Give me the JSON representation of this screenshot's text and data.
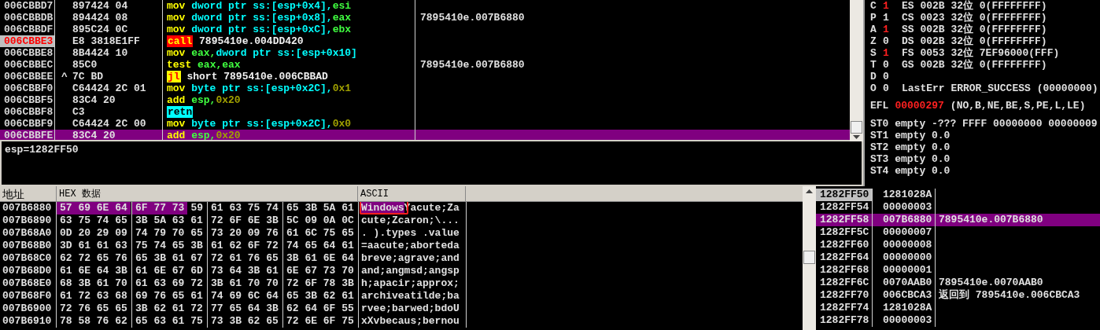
{
  "disassembly": {
    "rows": [
      {
        "address": "006CBBD7",
        "bytes": "897424 04",
        "tokens": [
          {
            "text": "mov",
            "kind": "mnemonic"
          },
          {
            "text": "dword ptr ss:[esp+0x4],",
            "kind": "memory"
          },
          {
            "text": "esi",
            "kind": "register"
          }
        ],
        "breakpoint": false,
        "selected": false
      },
      {
        "address": "006CBBDB",
        "bytes": "894424 08",
        "tokens": [
          {
            "text": "mov",
            "kind": "mnemonic"
          },
          {
            "text": "dword ptr ss:[esp+0x8],",
            "kind": "memory"
          },
          {
            "text": "eax",
            "kind": "register"
          }
        ],
        "comment": "7895410e.007B6880",
        "breakpoint": false,
        "selected": false
      },
      {
        "address": "006CBBDF",
        "bytes": "895C24 0C",
        "tokens": [
          {
            "text": "mov",
            "kind": "mnemonic"
          },
          {
            "text": "dword ptr ss:[esp+0xC],",
            "kind": "memory"
          },
          {
            "text": "ebx",
            "kind": "register"
          }
        ],
        "breakpoint": false,
        "selected": false
      },
      {
        "address": "006CBBE3",
        "bytes": "E8 3818E1FF",
        "tokens": [
          {
            "text": "call",
            "kind": "call"
          },
          {
            "text": "7895410e.004DD420",
            "kind": "plain"
          }
        ],
        "breakpoint": true,
        "selected": false
      },
      {
        "address": "006CBBE8",
        "bytes": "8B4424 10",
        "tokens": [
          {
            "text": "mov",
            "kind": "mnemonic"
          },
          {
            "text": "eax,",
            "kind": "register"
          },
          {
            "text": "dword ptr ss:[esp+0x10]",
            "kind": "memory"
          }
        ],
        "breakpoint": false,
        "selected": false
      },
      {
        "address": "006CBBEC",
        "bytes": "85C0",
        "tokens": [
          {
            "text": "test",
            "kind": "mnemonic"
          },
          {
            "text": "eax,eax",
            "kind": "register"
          }
        ],
        "comment": "7895410e.007B6880",
        "breakpoint": false,
        "selected": false
      },
      {
        "address": "006CBBEE",
        "arrow": "^",
        "bytes": "7C BD",
        "tokens": [
          {
            "text": "jl",
            "kind": "jump"
          },
          {
            "text": "short 7895410e.006CBBAD",
            "kind": "plain"
          }
        ],
        "breakpoint": false,
        "selected": false
      },
      {
        "address": "006CBBF0",
        "bytes": "C64424 2C 01",
        "tokens": [
          {
            "text": "mov",
            "kind": "mnemonic"
          },
          {
            "text": "byte ptr ss:[esp+0x2C],",
            "kind": "memory"
          },
          {
            "text": "0x1",
            "kind": "immediate"
          }
        ],
        "breakpoint": false,
        "selected": false
      },
      {
        "address": "006CBBF5",
        "bytes": "83C4 20",
        "tokens": [
          {
            "text": "add",
            "kind": "mnemonic"
          },
          {
            "text": "esp,",
            "kind": "register"
          },
          {
            "text": "0x20",
            "kind": "immediate"
          }
        ],
        "breakpoint": false,
        "selected": false
      },
      {
        "address": "006CBBF8",
        "bytes": "C3",
        "tokens": [
          {
            "text": "retn",
            "kind": "return"
          }
        ],
        "breakpoint": false,
        "selected": false
      },
      {
        "address": "006CBBF9",
        "bytes": "C64424 2C 00",
        "tokens": [
          {
            "text": "mov",
            "kind": "mnemonic"
          },
          {
            "text": "byte ptr ss:[esp+0x2C],",
            "kind": "memory"
          },
          {
            "text": "0x0",
            "kind": "immediate"
          }
        ],
        "breakpoint": false,
        "selected": false
      },
      {
        "address": "006CBBFE",
        "bytes": "83C4 20",
        "tokens": [
          {
            "text": "add",
            "kind": "mnemonic"
          },
          {
            "text": "esp,",
            "kind": "register"
          },
          {
            "text": "0x20",
            "kind": "immediate"
          }
        ],
        "breakpoint": false,
        "selected": true
      }
    ]
  },
  "info": "esp=1282FF50",
  "registers": {
    "flags": [
      {
        "flag": "C",
        "value": "1",
        "changed": true,
        "detail": "ES 002B 32位 0(FFFFFFFF)"
      },
      {
        "flag": "P",
        "value": "1",
        "changed": false,
        "detail": "CS 0023 32位 0(FFFFFFFF)"
      },
      {
        "flag": "A",
        "value": "1",
        "changed": true,
        "detail": "SS 002B 32位 0(FFFFFFFF)"
      },
      {
        "flag": "Z",
        "value": "0",
        "changed": false,
        "detail": "DS 002B 32位 0(FFFFFFFF)"
      },
      {
        "flag": "S",
        "value": "1",
        "changed": true,
        "detail": "FS 0053 32位 7EF96000(FFF)"
      },
      {
        "flag": "T",
        "value": "0",
        "changed": false,
        "detail": "GS 002B 32位 0(FFFFFFFF)"
      },
      {
        "flag": "D",
        "value": "0",
        "changed": false
      },
      {
        "flag": "O",
        "value": "0",
        "changed": false,
        "detail": "LastErr ERROR_SUCCESS (00000000)"
      }
    ],
    "efl": {
      "label": "EFL",
      "value": "00000297",
      "changed": true,
      "detail": "(NO,B,NE,BE,S,PE,L,LE)"
    },
    "fpu": [
      "ST0 empty -??? FFFF 00000000 00000009",
      "ST1 empty 0.0",
      "ST2 empty 0.0",
      "ST3 empty 0.0",
      "ST4 empty 0.0"
    ]
  },
  "dump": {
    "columns": [
      "地址",
      "HEX 数据",
      "ASCII"
    ],
    "rows": [
      {
        "address": "007B6880",
        "hex": [
          {
            "text": "57 69 6E 64 6F 77 73",
            "selected": true
          },
          {
            "text": "59 61 63 75 74 65 3B 5A 61",
            "selected": false
          }
        ],
        "ascii": [
          {
            "text": "Windows",
            "selected": true
          },
          {
            "text": "Yacute;Za",
            "selected": false
          }
        ]
      },
      {
        "address": "007B6890",
        "hex": [
          {
            "text": "63 75 74 65 3B 5A 63 61 72 6F 6E 3B 5C 09 0A 0C",
            "selected": false
          }
        ],
        "ascii": [
          {
            "text": "cute;Zcaron;\\...",
            "selected": false
          }
        ]
      },
      {
        "address": "007B68A0",
        "hex": [
          {
            "text": "0D 20 29 09 74 79 70 65 73 20 09 76 61 6C 75 65",
            "selected": false
          }
        ],
        "ascii": [
          {
            "text": ". ).types .value",
            "selected": false
          }
        ]
      },
      {
        "address": "007B68B0",
        "hex": [
          {
            "text": "3D 61 61 63 75 74 65 3B 61 62 6F 72 74 65 64 61",
            "selected": false
          }
        ],
        "ascii": [
          {
            "text": "=aacute;aborteda",
            "selected": false
          }
        ]
      },
      {
        "address": "007B68C0",
        "hex": [
          {
            "text": "62 72 65 76 65 3B 61 67 72 61 76 65 3B 61 6E 64",
            "selected": false
          }
        ],
        "ascii": [
          {
            "text": "breve;agrave;and",
            "selected": false
          }
        ]
      },
      {
        "address": "007B68D0",
        "hex": [
          {
            "text": "61 6E 64 3B 61 6E 67 6D 73 64 3B 61 6E 67 73 70",
            "selected": false
          }
        ],
        "ascii": [
          {
            "text": "and;angmsd;angsp",
            "selected": false
          }
        ]
      },
      {
        "address": "007B68E0",
        "hex": [
          {
            "text": "68 3B 61 70 61 63 69 72 3B 61 70 70 72 6F 78 3B",
            "selected": false
          }
        ],
        "ascii": [
          {
            "text": "h;apacir;approx;",
            "selected": false
          }
        ]
      },
      {
        "address": "007B68F0",
        "hex": [
          {
            "text": "61 72 63 68 69 76 65 61 74 69 6C 64 65 3B 62 61",
            "selected": false
          }
        ],
        "ascii": [
          {
            "text": "archiveatilde;ba",
            "selected": false
          }
        ]
      },
      {
        "address": "007B6900",
        "hex": [
          {
            "text": "72 76 65 65 3B 62 61 72 77 65 64 3B 62 64 6F 55",
            "selected": false
          }
        ],
        "ascii": [
          {
            "text": "rvee;barwed;bdoU",
            "selected": false
          }
        ]
      },
      {
        "address": "007B6910",
        "hex": [
          {
            "text": "78 58 76 62 65 63 61 75 73 3B 62 65 72 6E 6F 75",
            "selected": false
          }
        ],
        "ascii": [
          {
            "text": "xXvbecaus;bernou",
            "selected": false
          }
        ]
      }
    ]
  },
  "stack": {
    "rows": [
      {
        "address": "1282FF50",
        "value": "1281028A",
        "current": true,
        "selected": false
      },
      {
        "address": "1282FF54",
        "value": "00000003",
        "current": false,
        "selected": false
      },
      {
        "address": "1282FF58",
        "value": "007B6880",
        "comment": "7895410e.007B6880",
        "current": false,
        "selected": true
      },
      {
        "address": "1282FF5C",
        "value": "00000007",
        "current": false,
        "selected": false
      },
      {
        "address": "1282FF60",
        "value": "00000008",
        "current": false,
        "selected": false
      },
      {
        "address": "1282FF64",
        "value": "00000000",
        "current": false,
        "selected": false
      },
      {
        "address": "1282FF68",
        "value": "00000001",
        "current": false,
        "selected": false
      },
      {
        "address": "1282FF6C",
        "value": "0070AAB0",
        "comment": "7895410e.0070AAB0",
        "current": false,
        "selected": false
      },
      {
        "address": "1282FF70",
        "value": "006CBCA3",
        "comment": "返回到 7895410e.006CBCA3",
        "current": false,
        "selected": false
      },
      {
        "address": "1282FF74",
        "value": "1281028A",
        "current": false,
        "selected": false
      },
      {
        "address": "1282FF78",
        "value": "00000003",
        "current": false,
        "selected": false
      }
    ]
  }
}
